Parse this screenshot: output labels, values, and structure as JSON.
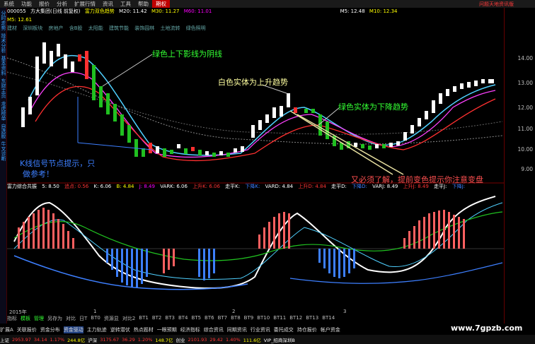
{
  "menu": {
    "items": [
      "系统",
      "功能",
      "报价",
      "分析",
      "扩展行情",
      "资讯",
      "工具",
      "帮助"
    ],
    "active": "期权",
    "promo": "问题天地资讯版"
  },
  "sidebar": {
    "items": [
      "分时走势",
      "技术分析",
      "基本资料",
      "东财主页",
      "龙虎榜单",
      "自选股",
      "牛叉诊断"
    ]
  },
  "infobar": {
    "code": "000055",
    "name": "方大集团(日线 前复权)",
    "formula": "富力双色趋势",
    "ma20": "M20: 11.42",
    "ma30": "M30: 11.27",
    "ma60": "M60: 11.01",
    "m5": "M5: 12.48",
    "m10": "M10: 12.34"
  },
  "sublabel": "M5: 12.61",
  "tags": [
    "建材",
    "深圳板块",
    "房地产",
    "含B股",
    "太阳能",
    "建筑节能",
    "装饰园林",
    "土地流转",
    "绿色照明"
  ],
  "axis": {
    "ticks": [
      "14.00",
      "13.00",
      "12.00",
      "11.00",
      "10.00",
      "9.00"
    ]
  },
  "annotations": {
    "green_shadow": "绿色上下影线为阴线",
    "white_up": "白色实体为上升趋势",
    "green_down": "绿色实体为下降趋势",
    "kline_hint_1": "K线信号节点提示，只",
    "kline_hint_2": "做参考！",
    "must_know": "又必须了解，提前变色提示你注意变盘"
  },
  "indbar": {
    "title": "富力综合共振",
    "a": "5: 8.50",
    "b": "追点: 0.56",
    "k": "K: 6.06",
    "r1": "B: 4.84",
    "j": "J: 8.49",
    "vark": "VARK: 6.06",
    "up": "上升K: 6.06",
    "flat": "走平K:",
    "down": "下降K:",
    "vard": "VARD: 4.84",
    "upd": "上升D: 4.84",
    "flatd": "走平D:",
    "downd": "下降D:",
    "varj": "VARJ: 8.49",
    "upj": "上升J: 8.49",
    "flatj": "走平J:",
    "downj": "下降J:"
  },
  "dates": {
    "year": "2015年",
    "d1": "1",
    "d2": "2",
    "d3": "3"
  },
  "tabs1": [
    "指标",
    "模板",
    "管理",
    "另存为",
    "对比",
    "日T",
    "BT0",
    "资源显",
    "对比2",
    "BT1",
    "BT2",
    "BT3",
    "BT4",
    "BT5",
    "BT6",
    "BT7",
    "BT8",
    "BT9",
    "BT10",
    "BT11",
    "BT12",
    "BT13",
    "BT14"
  ],
  "tabs2": [
    "扩展A",
    "关联报价",
    "资金分布",
    "资金驱动",
    "主力轨迹",
    "逆转潜伏",
    "热点题材",
    "一眼预期",
    "经济指标",
    "综合资讯",
    "同期资讯",
    "行业资讯",
    "委托成交",
    "持仓报价",
    "帐户资金"
  ],
  "status": {
    "sh": "上证",
    "sh_v": "2953.97",
    "sh_c": "34.14",
    "sh_p": "1.17%",
    "amt1": "244.8亿",
    "hs": "沪深",
    "hs_v": "3175.67",
    "hs_c": "36.29",
    "hs_p": "1.20%",
    "amt2": "148.7亿",
    "cy": "创业",
    "cy_v": "2101.93",
    "cy_c": "29.42",
    "cy_p": "1.40%",
    "amt3": "111.6亿",
    "vip": "VIP_招商深圳B"
  },
  "watermark": "www.7gpzb.com",
  "colors": {
    "up": "#ff3030",
    "down": "#00e0e0",
    "green": "#20c020",
    "white": "#ffffff",
    "yellow": "#ffff00",
    "blue": "#3d7fff",
    "magenta": "#ff40ff"
  }
}
